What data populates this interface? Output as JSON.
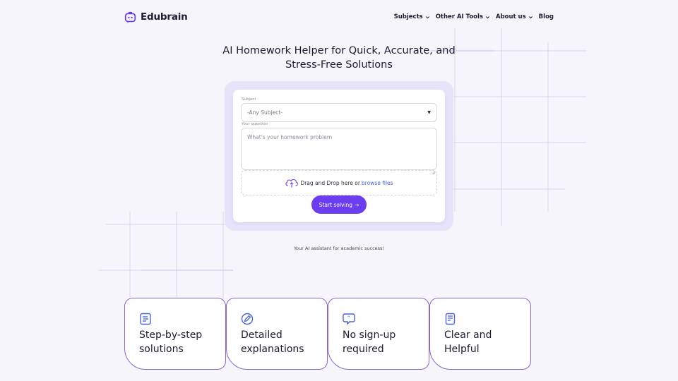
{
  "header": {
    "brand": "Edubrain",
    "nav": [
      {
        "label": "Subjects",
        "has_dropdown": true
      },
      {
        "label": "Other AI Tools",
        "has_dropdown": true
      },
      {
        "label": "About us",
        "has_dropdown": true
      },
      {
        "label": "Blog",
        "has_dropdown": false
      }
    ]
  },
  "hero": {
    "title_line1": "AI Homework Helper for Quick, Accurate, and",
    "title_line2": "Stress-Free Solutions"
  },
  "form": {
    "subject_label": "Subject",
    "subject_value": "-Any Subject-",
    "question_label": "Your question",
    "question_placeholder": "What's your homework problem",
    "drop_text": "Drag and Drop here or",
    "browse_text": "browse files",
    "submit_label": "Start solving",
    "submit_arrow": "→"
  },
  "tagline": "Your AI assistant for academic success!",
  "features": [
    {
      "line1": "Step-by-step",
      "line2": "solutions",
      "icon": "list-icon"
    },
    {
      "line1": "Detailed",
      "line2": "explanations",
      "icon": "pencil-icon"
    },
    {
      "line1": "No sign-up",
      "line2": "required",
      "icon": "quote-icon"
    },
    {
      "line1": "Clear and",
      "line2": "Helpful",
      "icon": "document-icon"
    }
  ],
  "colors": {
    "accent": "#6a3df0",
    "feature_icon": "#4a63d6",
    "feature_border": "#8a67c9",
    "form_frame": "#e7e3fb",
    "link": "#4a63d6"
  }
}
